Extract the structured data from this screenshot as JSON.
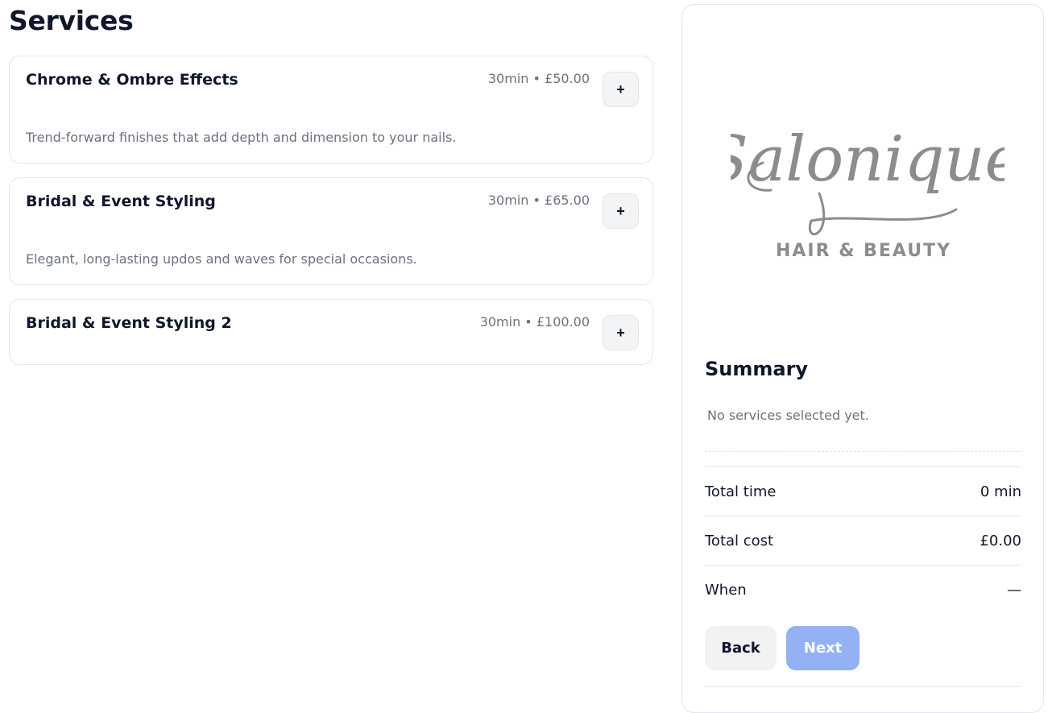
{
  "page": {
    "title": "Services"
  },
  "services": [
    {
      "name": "Chrome & Ombre Effects",
      "meta": "30min • £50.00",
      "description": "Trend-forward finishes that add depth and dimension to your nails.",
      "add_label": "+"
    },
    {
      "name": "Bridal & Event Styling",
      "meta": "30min • £65.00",
      "description": "Elegant, long-lasting updos and waves for special occasions.",
      "add_label": "+"
    },
    {
      "name": "Bridal & Event Styling 2",
      "meta": "30min • £100.00",
      "description": "",
      "add_label": "+"
    }
  ],
  "logo": {
    "script_text": "Salonique",
    "tagline": "HAIR & BEAUTY",
    "color": "#8c8c8c"
  },
  "summary": {
    "title": "Summary",
    "empty_text": "No services selected yet.",
    "rows": [
      {
        "label": "Total time",
        "value": "0 min"
      },
      {
        "label": "Total cost",
        "value": "£0.00"
      },
      {
        "label": "When",
        "value": "—"
      }
    ],
    "back_label": "Back",
    "next_label": "Next"
  },
  "colors": {
    "text_primary": "#0f172a",
    "text_muted": "#6b7280",
    "border": "#e3e6ea",
    "next_button": "#93b1f4"
  }
}
